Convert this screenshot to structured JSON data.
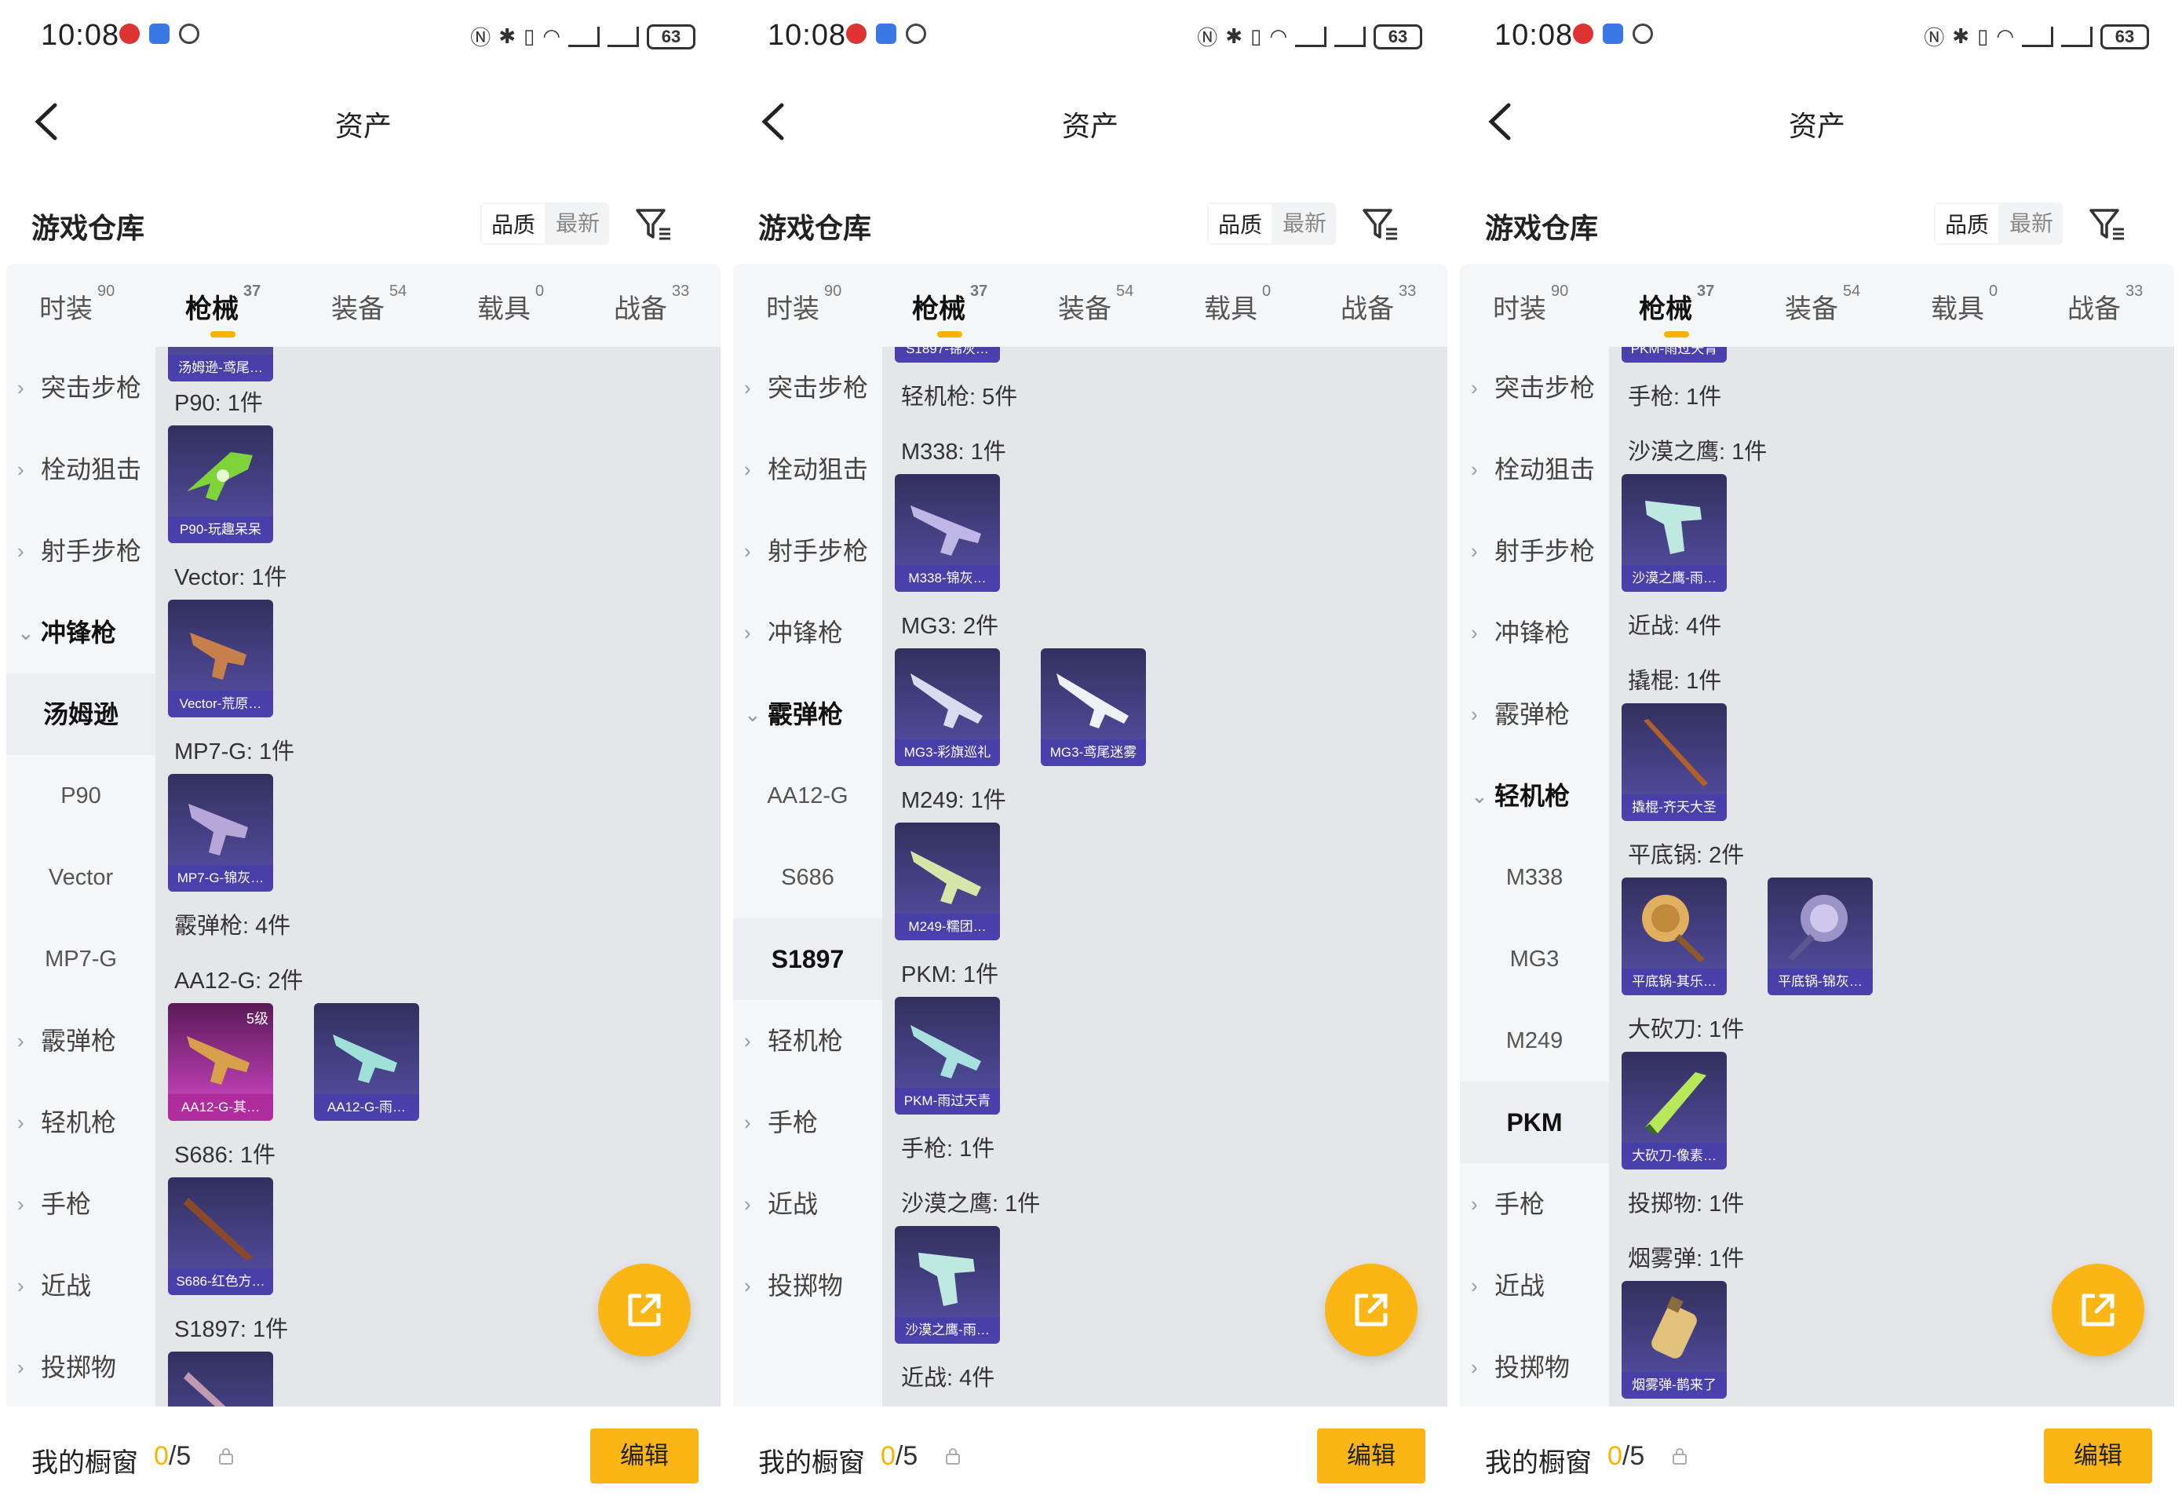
{
  "colors": {
    "accent": "#fbb616",
    "tab_indicator": "#f6b400",
    "card_purple": "#504a9a",
    "card_pink": "#b03aa8"
  },
  "panels": [
    {
      "status": {
        "time": "10:08",
        "battery": "63"
      },
      "nav": {
        "title": "资产"
      },
      "section": {
        "title": "游戏仓库",
        "sort_quality": "品质",
        "sort_latest": "最新"
      },
      "tabs": [
        {
          "label": "时装",
          "count": "90"
        },
        {
          "label": "枪械",
          "count": "37"
        },
        {
          "label": "装备",
          "count": "54"
        },
        {
          "label": "载具",
          "count": "0"
        },
        {
          "label": "战备",
          "count": "33"
        }
      ],
      "sidebar": [
        {
          "label": "突击步枪",
          "type": "cat"
        },
        {
          "label": "栓动狙击",
          "type": "cat"
        },
        {
          "label": "射手步枪",
          "type": "cat"
        },
        {
          "label": "冲锋枪",
          "type": "expanded"
        },
        {
          "label": "汤姆逊",
          "type": "active"
        },
        {
          "label": "P90",
          "type": "sub"
        },
        {
          "label": "Vector",
          "type": "sub"
        },
        {
          "label": "MP7-G",
          "type": "sub"
        },
        {
          "label": "霰弹枪",
          "type": "cat"
        },
        {
          "label": "轻机枪",
          "type": "cat"
        },
        {
          "label": "手枪",
          "type": "cat"
        },
        {
          "label": "近战",
          "type": "cat"
        },
        {
          "label": "投掷物",
          "type": "cat"
        }
      ],
      "labels": [
        "P90: 1件",
        "Vector: 1件",
        "MP7-G: 1件",
        "霰弹枪: 4件",
        "AA12-G: 2件",
        "S686: 1件",
        "S1897: 1件"
      ],
      "cards": [
        {
          "name": "汤姆逊-鸢尾…",
          "icon": "smg-icon",
          "level": ""
        },
        {
          "name": "P90-玩趣呆呆",
          "icon": "p90-icon",
          "level": ""
        },
        {
          "name": "Vector-荒原…",
          "icon": "vector-icon",
          "level": ""
        },
        {
          "name": "MP7-G-锦灰…",
          "icon": "smg-icon",
          "level": ""
        },
        {
          "name": "AA12-G-其…",
          "icon": "shotgun-icon",
          "level": "5级"
        },
        {
          "name": "AA12-G-雨…",
          "icon": "rifle-icon",
          "level": ""
        },
        {
          "name": "S686-红色方…",
          "icon": "shotgun-icon",
          "level": ""
        },
        {
          "name": "",
          "icon": "shotgun-icon",
          "level": ""
        }
      ],
      "bottom": {
        "label": "我的橱窗",
        "current": "0",
        "total": "/5",
        "edit": "编辑"
      }
    },
    {
      "status": {
        "time": "10:08",
        "battery": "63"
      },
      "nav": {
        "title": "资产"
      },
      "section": {
        "title": "游戏仓库",
        "sort_quality": "品质",
        "sort_latest": "最新"
      },
      "tabs": [
        {
          "label": "时装",
          "count": "90"
        },
        {
          "label": "枪械",
          "count": "37"
        },
        {
          "label": "装备",
          "count": "54"
        },
        {
          "label": "载具",
          "count": "0"
        },
        {
          "label": "战备",
          "count": "33"
        }
      ],
      "sidebar": [
        {
          "label": "突击步枪",
          "type": "cat"
        },
        {
          "label": "栓动狙击",
          "type": "cat"
        },
        {
          "label": "射手步枪",
          "type": "cat"
        },
        {
          "label": "冲锋枪",
          "type": "cat"
        },
        {
          "label": "霰弹枪",
          "type": "expanded"
        },
        {
          "label": "AA12-G",
          "type": "sub"
        },
        {
          "label": "S686",
          "type": "sub"
        },
        {
          "label": "S1897",
          "type": "active"
        },
        {
          "label": "轻机枪",
          "type": "cat"
        },
        {
          "label": "手枪",
          "type": "cat"
        },
        {
          "label": "近战",
          "type": "cat"
        },
        {
          "label": "投掷物",
          "type": "cat"
        }
      ],
      "labels": [
        "轻机枪: 5件",
        "M338: 1件",
        "MG3: 2件",
        "M249: 1件",
        "PKM: 1件",
        "手枪: 1件",
        "沙漠之鹰: 1件",
        "近战: 4件"
      ],
      "cards": [
        {
          "name": "S1897-锦灰…",
          "icon": "shotgun-icon",
          "level": ""
        },
        {
          "name": "M338-锦灰…",
          "icon": "lmg-icon",
          "level": ""
        },
        {
          "name": "MG3-彩旗巡礼",
          "icon": "lmg-icon",
          "level": ""
        },
        {
          "name": "MG3-鸢尾迷雾",
          "icon": "lmg-icon",
          "level": ""
        },
        {
          "name": "M249-糯团…",
          "icon": "lmg-icon",
          "level": ""
        },
        {
          "name": "PKM-雨过天青",
          "icon": "lmg-icon",
          "level": ""
        },
        {
          "name": "沙漠之鹰-雨…",
          "icon": "pistol-icon",
          "level": ""
        }
      ],
      "bottom": {
        "label": "我的橱窗",
        "current": "0",
        "total": "/5",
        "edit": "编辑"
      }
    },
    {
      "status": {
        "time": "10:08",
        "battery": "63"
      },
      "nav": {
        "title": "资产"
      },
      "section": {
        "title": "游戏仓库",
        "sort_quality": "品质",
        "sort_latest": "最新"
      },
      "tabs": [
        {
          "label": "时装",
          "count": "90"
        },
        {
          "label": "枪械",
          "count": "37"
        },
        {
          "label": "装备",
          "count": "54"
        },
        {
          "label": "载具",
          "count": "0"
        },
        {
          "label": "战备",
          "count": "33"
        }
      ],
      "sidebar": [
        {
          "label": "突击步枪",
          "type": "cat"
        },
        {
          "label": "栓动狙击",
          "type": "cat"
        },
        {
          "label": "射手步枪",
          "type": "cat"
        },
        {
          "label": "冲锋枪",
          "type": "cat"
        },
        {
          "label": "霰弹枪",
          "type": "cat"
        },
        {
          "label": "轻机枪",
          "type": "expanded"
        },
        {
          "label": "M338",
          "type": "sub"
        },
        {
          "label": "MG3",
          "type": "sub"
        },
        {
          "label": "M249",
          "type": "sub"
        },
        {
          "label": "PKM",
          "type": "active"
        },
        {
          "label": "手枪",
          "type": "cat"
        },
        {
          "label": "近战",
          "type": "cat"
        },
        {
          "label": "投掷物",
          "type": "cat"
        }
      ],
      "labels": [
        "手枪: 1件",
        "沙漠之鹰: 1件",
        "近战: 4件",
        "撬棍: 1件",
        "平底锅: 2件",
        "大砍刀: 1件",
        "投掷物: 1件",
        "烟雾弹: 1件"
      ],
      "cards": [
        {
          "name": "PKM-雨过天青",
          "icon": "lmg-icon",
          "level": ""
        },
        {
          "name": "沙漠之鹰-雨…",
          "icon": "pistol-icon",
          "level": ""
        },
        {
          "name": "撬棍-齐天大圣",
          "icon": "crowbar-icon",
          "level": ""
        },
        {
          "name": "平底锅-其乐…",
          "icon": "pan-icon",
          "level": ""
        },
        {
          "name": "平底锅-锦灰…",
          "icon": "pan-icon",
          "level": ""
        },
        {
          "name": "大砍刀-像素…",
          "icon": "machete-icon",
          "level": ""
        },
        {
          "name": "烟雾弹-鹊来了",
          "icon": "grenade-icon",
          "level": ""
        }
      ],
      "bottom": {
        "label": "我的橱窗",
        "current": "0",
        "total": "/5",
        "edit": "编辑"
      }
    }
  ]
}
